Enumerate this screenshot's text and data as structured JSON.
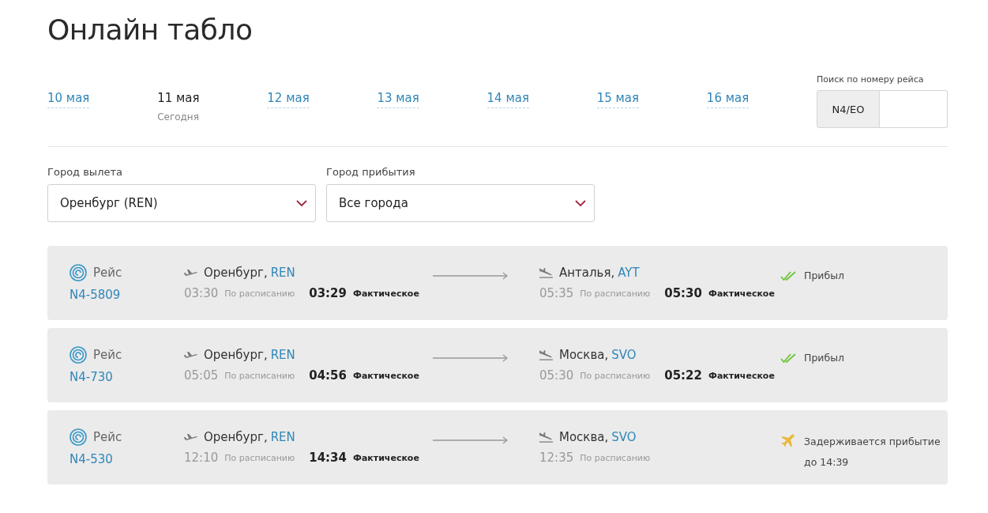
{
  "title": "Онлайн табло",
  "dates": [
    {
      "label": "10 мая",
      "selected": false
    },
    {
      "label": "11 мая",
      "selected": true,
      "note": "Сегодня"
    },
    {
      "label": "12 мая",
      "selected": false
    },
    {
      "label": "13 мая",
      "selected": false
    },
    {
      "label": "14 мая",
      "selected": false
    },
    {
      "label": "15 мая",
      "selected": false
    },
    {
      "label": "16 мая",
      "selected": false
    }
  ],
  "flight_search": {
    "label": "Поиск по номеру рейса",
    "prefix": "N4/EO"
  },
  "filters": [
    {
      "label": "Город вылета",
      "value": "Оренбург (REN)"
    },
    {
      "label": "Город прибытия",
      "value": "Все города"
    }
  ],
  "flights": [
    {
      "flight_label": "Рейс",
      "number": "N4-5809",
      "from_city": "Оренбург,",
      "from_code": "REN",
      "dep_scheduled": "03:30",
      "dep_scheduled_label": "По расписанию",
      "dep_actual": "03:29",
      "dep_actual_label": "Фактическое",
      "to_city": "Анталья,",
      "to_code": "AYT",
      "arr_scheduled": "05:35",
      "arr_scheduled_label": "По расписанию",
      "arr_actual": "05:30",
      "arr_actual_label": "Фактическое",
      "status": {
        "kind": "arrived",
        "text": "Прибыл"
      }
    },
    {
      "flight_label": "Рейс",
      "number": "N4-730",
      "from_city": "Оренбург,",
      "from_code": "REN",
      "dep_scheduled": "05:05",
      "dep_scheduled_label": "По расписанию",
      "dep_actual": "04:56",
      "dep_actual_label": "Фактическое",
      "to_city": "Москва,",
      "to_code": "SVO",
      "arr_scheduled": "05:30",
      "arr_scheduled_label": "По расписанию",
      "arr_actual": "05:22",
      "arr_actual_label": "Фактическое",
      "status": {
        "kind": "arrived",
        "text": "Прибыл"
      }
    },
    {
      "flight_label": "Рейс",
      "number": "N4-530",
      "from_city": "Оренбург,",
      "from_code": "REN",
      "dep_scheduled": "12:10",
      "dep_scheduled_label": "По расписанию",
      "dep_actual": "14:34",
      "dep_actual_label": "Фактическое",
      "to_city": "Москва,",
      "to_code": "SVO",
      "arr_scheduled": "12:35",
      "arr_scheduled_label": "По расписанию",
      "status": {
        "kind": "delayed",
        "text": "Задерживается прибытие",
        "detail": "до 14:39"
      }
    }
  ]
}
